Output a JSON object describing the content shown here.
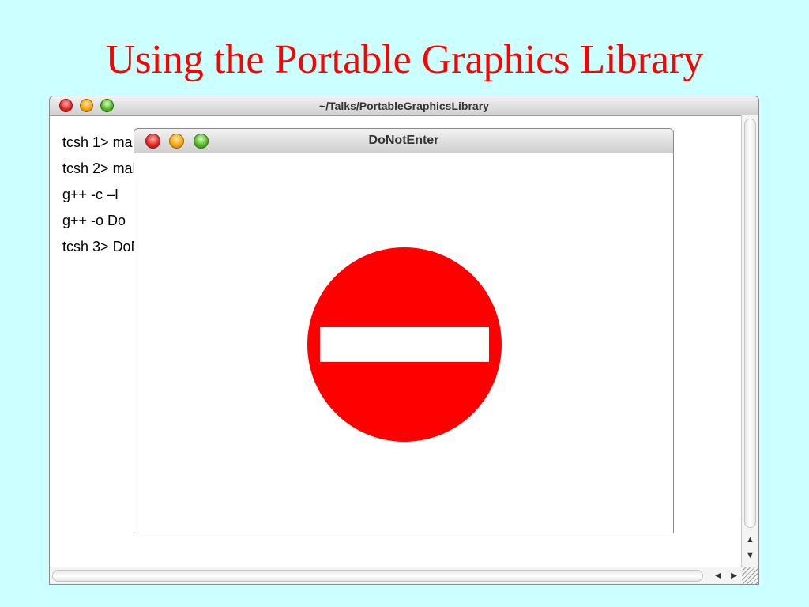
{
  "slide": {
    "title": "Using the Portable Graphics Library"
  },
  "terminal_window": {
    "title": "~/Talks/PortableGraphicsLibrary",
    "lines": [
      {
        "prompt": "tcsh 1>",
        "command": "ma"
      },
      {
        "prompt": "tcsh 2>",
        "command": "mak"
      },
      {
        "prompt": "",
        "command": "g++ -c –I"
      },
      {
        "prompt": "",
        "command": "g++ -o Do"
      },
      {
        "prompt": "tcsh 3>",
        "command": "DoN"
      }
    ]
  },
  "dne_window": {
    "title": "DoNotEnter",
    "sign": {
      "circle_color": "#ff0000",
      "bar_color": "#ffffff",
      "background": "#ffffff"
    }
  },
  "colors": {
    "background": "#ccffff",
    "title": "#ff0000"
  },
  "icons": {
    "close": "close-icon",
    "minimize": "minimize-icon",
    "zoom": "zoom-icon",
    "arrow_up": "▲",
    "arrow_down": "▼",
    "arrow_left": "◀",
    "arrow_right": "▶"
  }
}
